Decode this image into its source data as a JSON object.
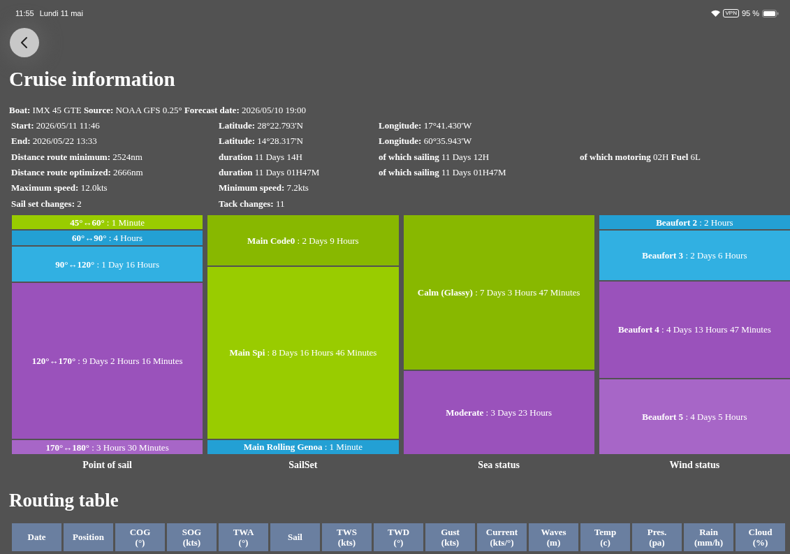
{
  "status_bar": {
    "time": "11:55",
    "date": "Lundi 11 mai",
    "vpn": "VPN",
    "battery": "95 %"
  },
  "title": "Cruise information",
  "summary": "**Boat:** IMX 45 GTE **Source:** NOAA GFS 0.25° **Forecast date:** 2026/05/10 19:00",
  "info_rows": [
    [
      "**Start:** 2026/05/11 11:46",
      "**Latitude:** 28°22.793'N",
      "**Longitude:** 17°41.430'W"
    ],
    [
      "**End:** 2026/05/22 13:33",
      "**Latitude:** 14°28.317'N",
      "**Longitude:** 60°35.943'W"
    ],
    [
      "**Distance route minimum:** 2524nm",
      "**duration** 11 Days 14H",
      "**of which sailing** 11 Days 12H",
      "**of which motoring** 02H **Fuel** 6L"
    ],
    [
      "**Distance route optimized:** 2666nm",
      "**duration** 11 Days 01H47M",
      "**of which sailing** 11 Days 01H47M"
    ],
    [
      "**Maximum speed:** 12.0kts",
      "**Minimum speed:** 7.2kts"
    ],
    [
      "**Sail set changes:** 2",
      "**Tack changes:** 11"
    ]
  ],
  "charts": [
    {
      "title": "Point of sail",
      "blocks": [
        {
          "label": "45°↔60°",
          "value": ": 1 Minute",
          "color": "#99cc00"
        },
        {
          "label": "60°↔90°",
          "value": ": 4 Hours",
          "color": "#23a0d4"
        },
        {
          "label": "90°↔120°",
          "value": ": 1 Day 16 Hours",
          "color": "#31b0e2"
        },
        {
          "label": "120°↔170°",
          "value": ": 9 Days 2 Hours 16 Minutes",
          "color": "#9a52bb"
        },
        {
          "label": "170°↔180°",
          "value": ": 3 Hours 30 Minutes",
          "color": "#a766c7"
        }
      ]
    },
    {
      "title": "SailSet",
      "blocks": [
        {
          "label": "Main Code0",
          "value": ": 2 Days 9 Hours",
          "color": "#88b800"
        },
        {
          "label": "Main Spi",
          "value": ": 8 Days 16 Hours 46 Minutes",
          "color": "#99cc00"
        },
        {
          "label": "Main Rolling Genoa",
          "value": ": 1 Minute",
          "color": "#23a0d4"
        }
      ]
    },
    {
      "title": "Sea status",
      "blocks": [
        {
          "label": "Calm (Glassy)",
          "value": ": 7 Days 3 Hours 47 Minutes",
          "color": "#88b800"
        },
        {
          "label": "Moderate",
          "value": ": 3 Days 23 Hours",
          "color": "#9a52bb"
        }
      ]
    },
    {
      "title": "Wind status",
      "blocks": [
        {
          "label": "Beaufort 2",
          "value": ": 2 Hours",
          "color": "#23a0d4"
        },
        {
          "label": "Beaufort 3",
          "value": ": 2 Days 6 Hours",
          "color": "#31b0e2"
        },
        {
          "label": "Beaufort 4",
          "value": ": 4 Days 13 Hours 47 Minutes",
          "color": "#9a52bb"
        },
        {
          "label": "Beaufort 5",
          "value": ": 4 Days 5 Hours",
          "color": "#a766c7"
        }
      ]
    }
  ],
  "routing_title": "Routing table",
  "table": {
    "columns": [
      {
        "label": "Date"
      },
      {
        "label": "Position"
      },
      {
        "label": "COG",
        "unit": "(°)"
      },
      {
        "label": "SOG",
        "unit": "(kts)"
      },
      {
        "label": "TWA",
        "unit": "(°)"
      },
      {
        "label": "Sail"
      },
      {
        "label": "TWS",
        "unit": "(kts)"
      },
      {
        "label": "TWD",
        "unit": "(°)"
      },
      {
        "label": "Gust",
        "unit": "(kts)"
      },
      {
        "label": "Current",
        "unit": "(kts/°)"
      },
      {
        "label": "Waves",
        "unit": "(m)"
      },
      {
        "label": "Temp",
        "unit": "(c)"
      },
      {
        "label": "Pres.",
        "unit": "(pa)"
      },
      {
        "label": "Rain",
        "unit": "(mm/h)"
      },
      {
        "label": "Cloud",
        "unit": "(%)"
      }
    ]
  }
}
